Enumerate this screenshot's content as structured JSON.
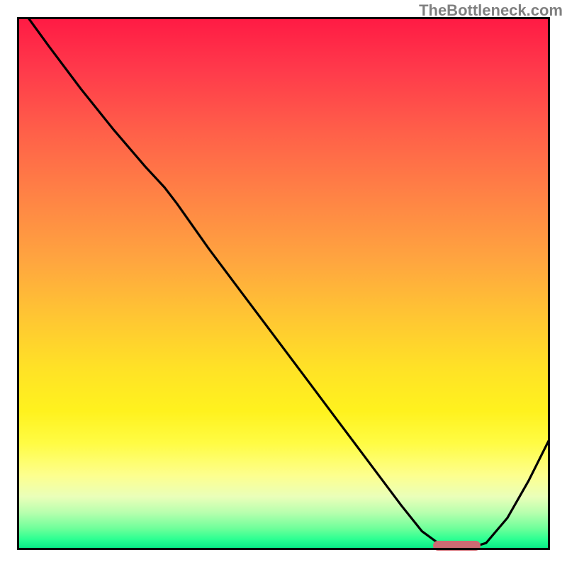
{
  "watermark": "TheBottleneck.com",
  "colors": {
    "curve": "#000000",
    "marker": "#cc6b73",
    "frame": "#000000"
  },
  "chart_data": {
    "type": "line",
    "title": "",
    "xlabel": "",
    "ylabel": "",
    "xlim": [
      0,
      100
    ],
    "ylim": [
      0,
      100
    ],
    "grid": false,
    "legend": false,
    "series": [
      {
        "name": "bottleneck-curve",
        "x": [
          2,
          6,
          12,
          18,
          24,
          27.7,
          30,
          36,
          42,
          48,
          54,
          60,
          66,
          72,
          76,
          79,
          82,
          85,
          88,
          92,
          96,
          100
        ],
        "y": [
          100,
          94.5,
          86.5,
          79,
          72,
          68,
          65,
          56.5,
          48.5,
          40.5,
          32.5,
          24.5,
          16.5,
          8.5,
          3.5,
          1.3,
          0.4,
          0.4,
          1.3,
          6,
          13,
          21
        ]
      }
    ],
    "annotations": [
      {
        "name": "optimal-range-marker",
        "type": "bar-segment",
        "x_start": 78,
        "x_end": 87,
        "y": 0.8,
        "color": "#cc6b73"
      }
    ]
  }
}
